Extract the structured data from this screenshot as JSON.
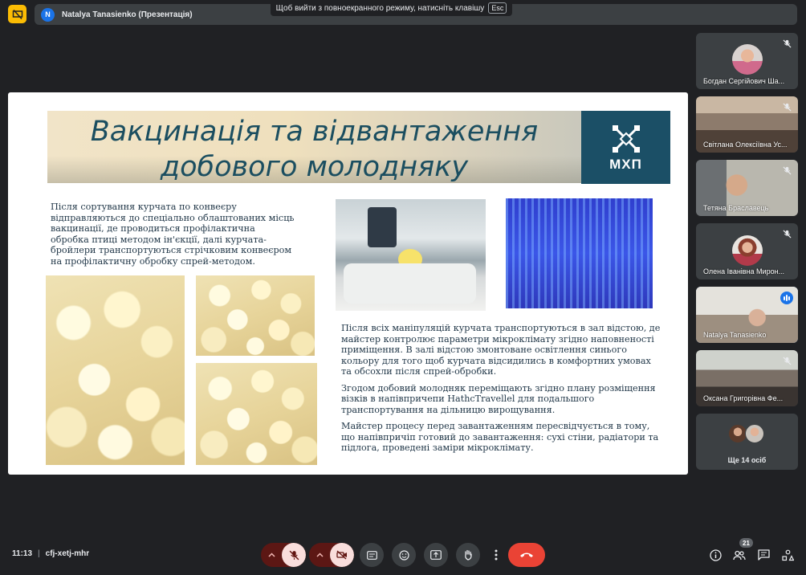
{
  "topbar": {
    "presenter_initial": "N",
    "presenter_title": "Natalya Tanasienko (Презентація)",
    "fullscreen_hint": "Щоб вийти з повноекранного режиму, натисніть клавішу",
    "esc_key": "Esc"
  },
  "slide": {
    "title_line1": "Вакцинація та відвантаження",
    "title_line2": "добового молодняку",
    "logo_text": "МХП",
    "intro_text": "Після сортування курчата по конвеєру відправляються до спеціально облаштованих місць вакцинації, де проводиться профілактична обробка птиці методом ін'єкції, далі курчата-бройлери транспортуються стрічковим конвеєром на профілактичну обробку спрей-методом.",
    "para1": "Після всіх маніпуляцій курчата транспортуються в зал відстою, де майстер контролює параметри мікроклімату згідно наповненості приміщення. В залі відстою змонтоване освітлення синього кольору  для того щоб курчата відсидились в комфортних умовах та обсохли після спрей-обробки.",
    "para2": "Згодом добовий молодняк переміщають згідно плану розміщення візків в напівпричепи HathcTravellel для подальшого транспортування на дільницю вирощування.",
    "para3": "Майстер процесу перед завантаженням пересвідчується в тому, що напівпричіп готовий до завантаження: сухі стіни, радіатори та підлога, проведені заміри мікроклімату."
  },
  "participants": [
    {
      "name": "Богдан Сергійович Ша...",
      "mic": "muted",
      "kind": "avatar"
    },
    {
      "name": "Світлана Олексіївна Ус...",
      "mic": "muted",
      "kind": "video"
    },
    {
      "name": "Тетяна Браславець",
      "mic": "muted",
      "kind": "video"
    },
    {
      "name": "Олена Іванівна Мирон...",
      "mic": "muted",
      "kind": "avatar"
    },
    {
      "name": "Natalya Tanasienko",
      "mic": "speaking",
      "kind": "video"
    },
    {
      "name": "Оксана Григорівна Фе...",
      "mic": "muted",
      "kind": "video"
    }
  ],
  "more_participants": "Ще 14 осіб",
  "bottombar": {
    "time": "11:13",
    "separator": "|",
    "meeting_code": "cfj-xetj-mhr",
    "people_count": "21"
  },
  "colors": {
    "background": "#202124",
    "surface": "#3c4043",
    "muted_control": "#f9dedc",
    "hangup": "#ea4335",
    "accent": "#1a73e8",
    "logo_bg": "#1b4f66"
  },
  "icons": [
    "presentation-off-icon",
    "mic-off-icon",
    "camera-off-icon",
    "captions-icon",
    "emoji-icon",
    "present-screen-icon",
    "raise-hand-icon",
    "more-options-icon",
    "hang-up-icon",
    "info-icon",
    "people-icon",
    "chat-icon",
    "activities-icon"
  ]
}
